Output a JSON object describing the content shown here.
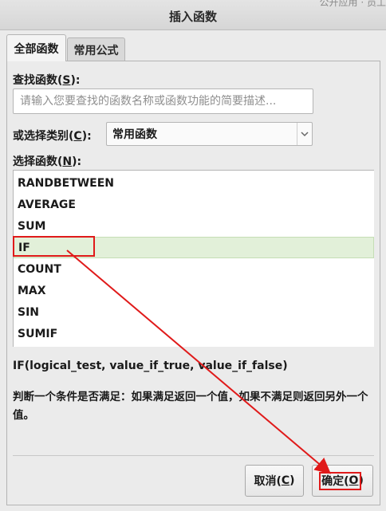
{
  "window": {
    "title": "插入函数",
    "background_text": "公开应用 · 员工"
  },
  "tabs": [
    {
      "label": "全部函数",
      "active": true
    },
    {
      "label": "常用公式",
      "active": false
    }
  ],
  "search": {
    "label_prefix": "查找函数(",
    "label_key": "S",
    "label_suffix": "):",
    "placeholder": "请输入您要查找的函数名称或函数功能的简要描述..."
  },
  "category": {
    "label_prefix": "或选择类别(",
    "label_key": "C",
    "label_suffix": "):",
    "selected": "常用函数"
  },
  "function_list": {
    "label_prefix": "选择函数(",
    "label_key": "N",
    "label_suffix": "):",
    "items": [
      "RANDBETWEEN",
      "AVERAGE",
      "SUM",
      "IF",
      "COUNT",
      "MAX",
      "SIN",
      "SUMIF"
    ],
    "selected": "IF"
  },
  "syntax": "IF(logical_test, value_if_true, value_if_false)",
  "description": "判断一个条件是否满足：如果满足返回一个值，如果不满足则返回另外一个值。",
  "buttons": {
    "cancel": {
      "prefix": "取消(",
      "key": "C",
      "suffix": ")"
    },
    "ok": {
      "prefix": "确定(",
      "key": "O",
      "suffix": ")"
    }
  },
  "colors": {
    "annotation": "#e01a1a",
    "selection": "#e2f0d9"
  }
}
